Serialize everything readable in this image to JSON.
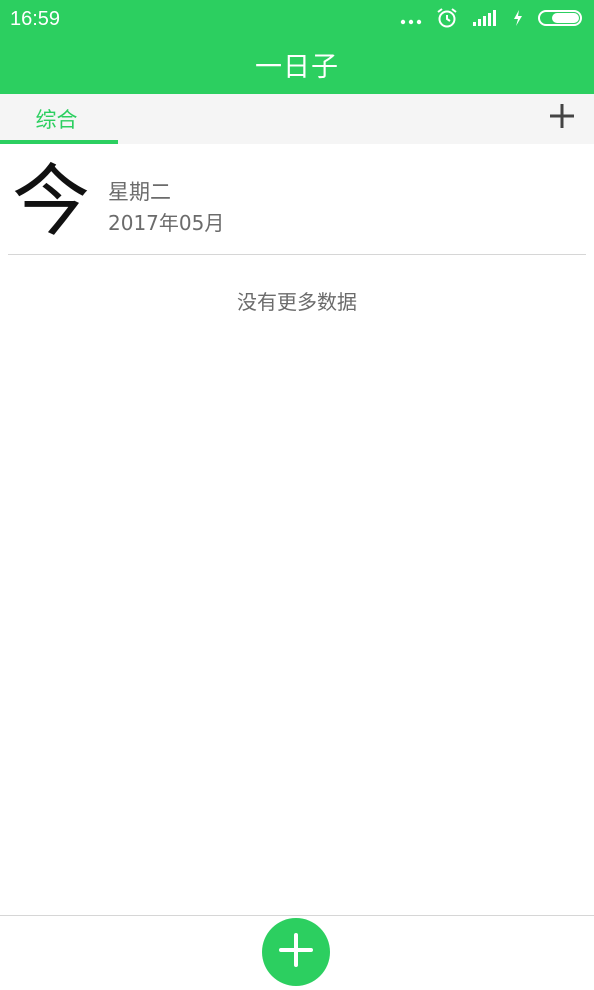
{
  "status_bar": {
    "time": "16:59",
    "icons": [
      "more-dots-icon",
      "alarm-clock-icon",
      "signal-icon",
      "charging-icon",
      "battery-icon"
    ]
  },
  "app": {
    "title": "一日子"
  },
  "tabs": [
    {
      "label": "综合",
      "selected": true
    }
  ],
  "tab_actions": {
    "add_icon": "plus-icon"
  },
  "entries": [
    {
      "big_char": "今",
      "weekday": "星期二",
      "month": "2017年05月"
    }
  ],
  "list_end_message": "没有更多数据",
  "fab": {
    "icon": "plus-icon"
  },
  "colors": {
    "accent": "#2ccf60",
    "text_secondary": "#6b6b6b",
    "divider": "#d6d6d6"
  }
}
